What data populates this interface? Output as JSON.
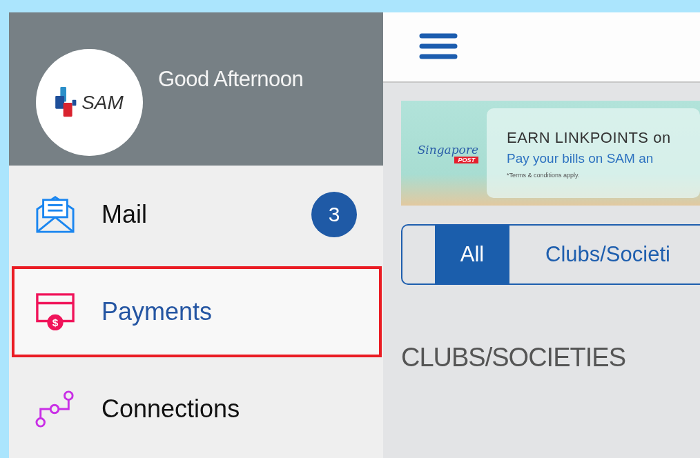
{
  "drawer": {
    "greeting": "Good Afternoon",
    "logo_text": "SAM",
    "items": [
      {
        "kind": "mail",
        "label": "Mail",
        "badge": "3",
        "selected": false,
        "highlighted": false
      },
      {
        "kind": "payments",
        "label": "Payments",
        "icon_glyph": "$",
        "selected": true,
        "highlighted": true
      },
      {
        "kind": "connections",
        "label": "Connections",
        "selected": false,
        "highlighted": false
      }
    ]
  },
  "main": {
    "banner": {
      "logo_text": "Singapore",
      "logo_tag": "POST",
      "headline": "EARN LINKPOINTS on",
      "subline": "Pay your bills on SAM an",
      "note": "*Terms & conditions apply."
    },
    "segments": [
      {
        "label": "All",
        "selected": true
      },
      {
        "label": "Clubs/Societi",
        "selected": false
      }
    ],
    "section_heading": "CLUBS/SOCIETIES"
  }
}
